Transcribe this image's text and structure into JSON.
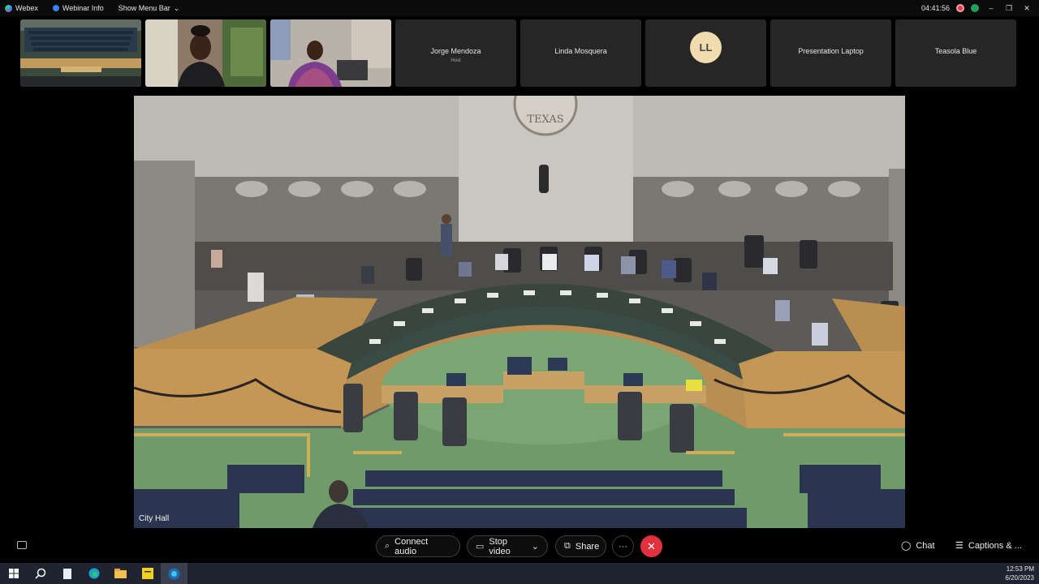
{
  "titlebar": {
    "app_name": "Webex",
    "menu_webinar_info": "Webinar Info",
    "menu_show_menu_bar": "Show Menu Bar",
    "timer": "04:41:56"
  },
  "participants": [
    {
      "name": "",
      "type": "video-room"
    },
    {
      "name": "",
      "type": "video-person"
    },
    {
      "name": "",
      "type": "video-person"
    },
    {
      "name": "Jorge Mendoza",
      "sub": "Host"
    },
    {
      "name": "Linda Mosquera",
      "sub": ""
    },
    {
      "name": "",
      "initials": "LL"
    },
    {
      "name": "Presentation Laptop",
      "sub": ""
    },
    {
      "name": "Teasola Blue",
      "sub": ""
    }
  ],
  "main_video": {
    "label": "City Hall",
    "seal_text": "TEXAS"
  },
  "controls": {
    "connect_audio": "Connect audio",
    "stop_video": "Stop video",
    "share": "Share",
    "more": "···",
    "end": "✕",
    "chat": "Chat",
    "captions": "Captions & ..."
  },
  "taskbar": {
    "time": "12:53 PM",
    "date": "6/20/2023"
  },
  "colors": {
    "end_button": "#e0313d",
    "background": "#000000",
    "tile": "#262626"
  }
}
